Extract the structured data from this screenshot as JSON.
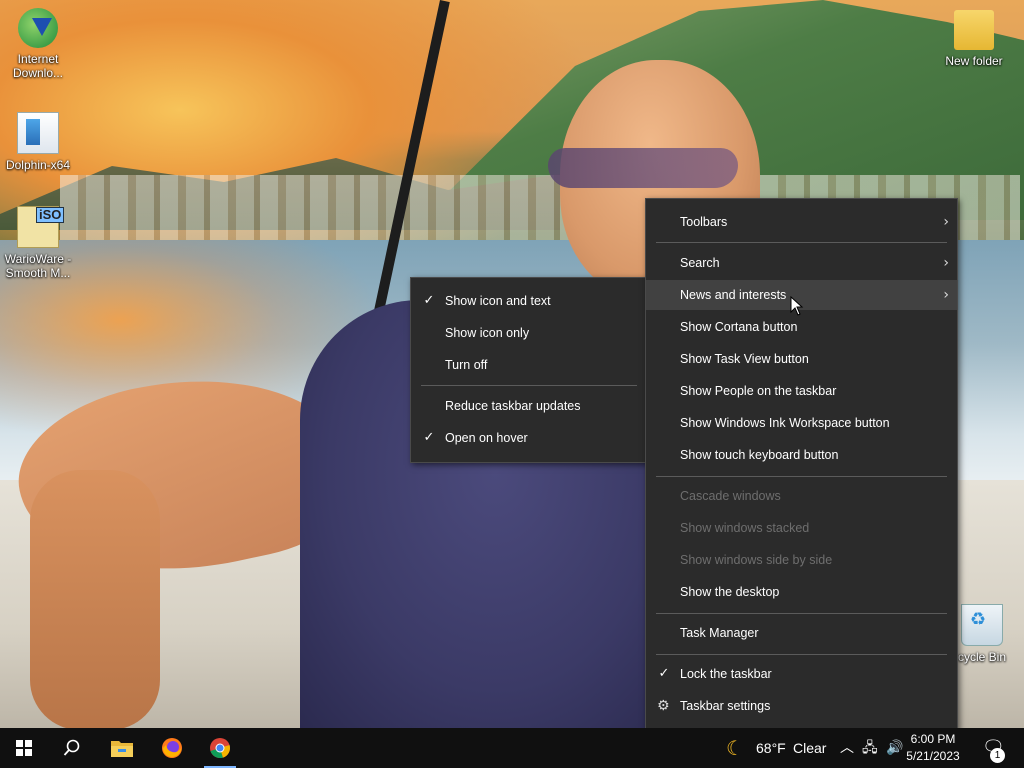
{
  "desktop": {
    "icons": [
      {
        "label": "Internet Downlo...",
        "icon": "idm-icon"
      },
      {
        "label": "Dolphin-x64",
        "icon": "dolphin-icon"
      },
      {
        "label": "WarioWare - Smooth M...",
        "icon": "iso-file-icon",
        "badge": "iSO"
      },
      {
        "label": "New folder",
        "icon": "folder-icon"
      },
      {
        "label": "cycle Bin",
        "icon": "recycle-bin-icon"
      }
    ]
  },
  "taskbar_menu": {
    "items": [
      {
        "label": "Toolbars",
        "submenu": true
      },
      {
        "label": "Search",
        "submenu": true
      },
      {
        "label": "News and interests",
        "submenu": true,
        "highlighted": true
      },
      {
        "label": "Show Cortana button"
      },
      {
        "label": "Show Task View button"
      },
      {
        "label": "Show People on the taskbar"
      },
      {
        "label": "Show Windows Ink Workspace button"
      },
      {
        "label": "Show touch keyboard button"
      },
      {
        "label": "Cascade windows",
        "disabled": true
      },
      {
        "label": "Show windows stacked",
        "disabled": true
      },
      {
        "label": "Show windows side by side",
        "disabled": true
      },
      {
        "label": "Show the desktop"
      },
      {
        "label": "Task Manager"
      },
      {
        "label": "Lock the taskbar",
        "checked": true
      },
      {
        "label": "Taskbar settings",
        "icon": "gear-icon"
      }
    ]
  },
  "news_submenu": {
    "items": [
      {
        "label": "Show icon and text",
        "checked": true
      },
      {
        "label": "Show icon only"
      },
      {
        "label": "Turn off"
      },
      {
        "label": "Reduce taskbar updates"
      },
      {
        "label": "Open on hover",
        "checked": true
      }
    ]
  },
  "taskbar": {
    "weather": {
      "temp": "68°F",
      "condition": "Clear",
      "icon": "moon-icon"
    },
    "clock": {
      "time": "6:00 PM",
      "date": "5/21/2023"
    },
    "notification_count": "1",
    "pinned": [
      "start-icon",
      "search-icon",
      "file-explorer-icon",
      "firefox-icon",
      "chrome-icon"
    ]
  },
  "colors": {
    "menu_bg": "#2b2b2b",
    "menu_hover": "#414141",
    "taskbar_bg": "#101010",
    "accent": "#7eb6ff"
  }
}
